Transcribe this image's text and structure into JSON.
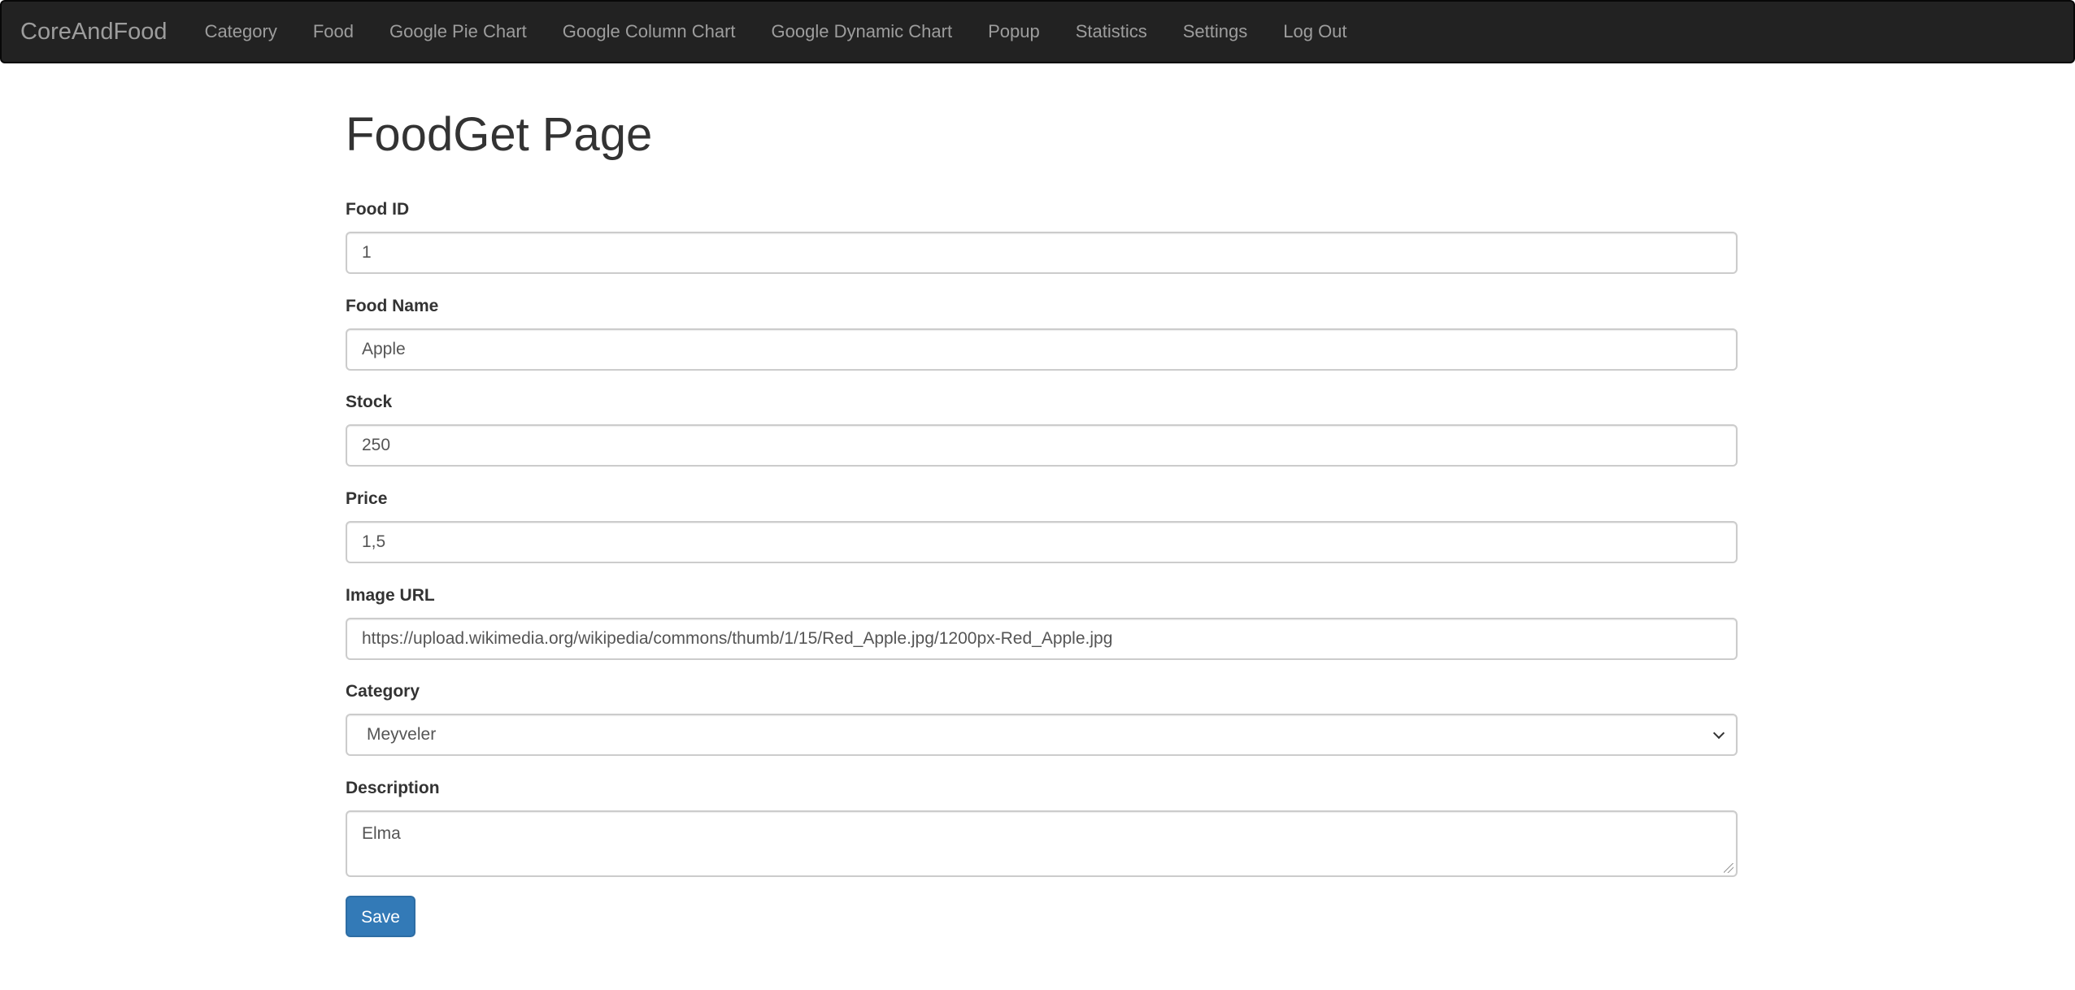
{
  "navbar": {
    "brand": "CoreAndFood",
    "items": [
      {
        "label": "Category"
      },
      {
        "label": "Food"
      },
      {
        "label": "Google Pie Chart"
      },
      {
        "label": "Google Column Chart"
      },
      {
        "label": "Google Dynamic Chart"
      },
      {
        "label": "Popup"
      },
      {
        "label": "Statistics"
      },
      {
        "label": "Settings"
      },
      {
        "label": "Log Out"
      }
    ],
    "background_color": "#222222",
    "text_color": "#9d9d9d"
  },
  "page": {
    "title": "FoodGet Page"
  },
  "form": {
    "food_id": {
      "label": "Food ID",
      "value": "1"
    },
    "food_name": {
      "label": "Food Name",
      "value": "Apple"
    },
    "stock": {
      "label": "Stock",
      "value": "250"
    },
    "price": {
      "label": "Price",
      "value": "1,5"
    },
    "image_url": {
      "label": "Image URL",
      "value": "https://upload.wikimedia.org/wikipedia/commons/thumb/1/15/Red_Apple.jpg/1200px-Red_Apple.jpg"
    },
    "category": {
      "label": "Category",
      "selected": "Meyveler"
    },
    "description": {
      "label": "Description",
      "value": "Elma"
    },
    "save_label": "Save",
    "save_button_color": "#337ab7"
  }
}
